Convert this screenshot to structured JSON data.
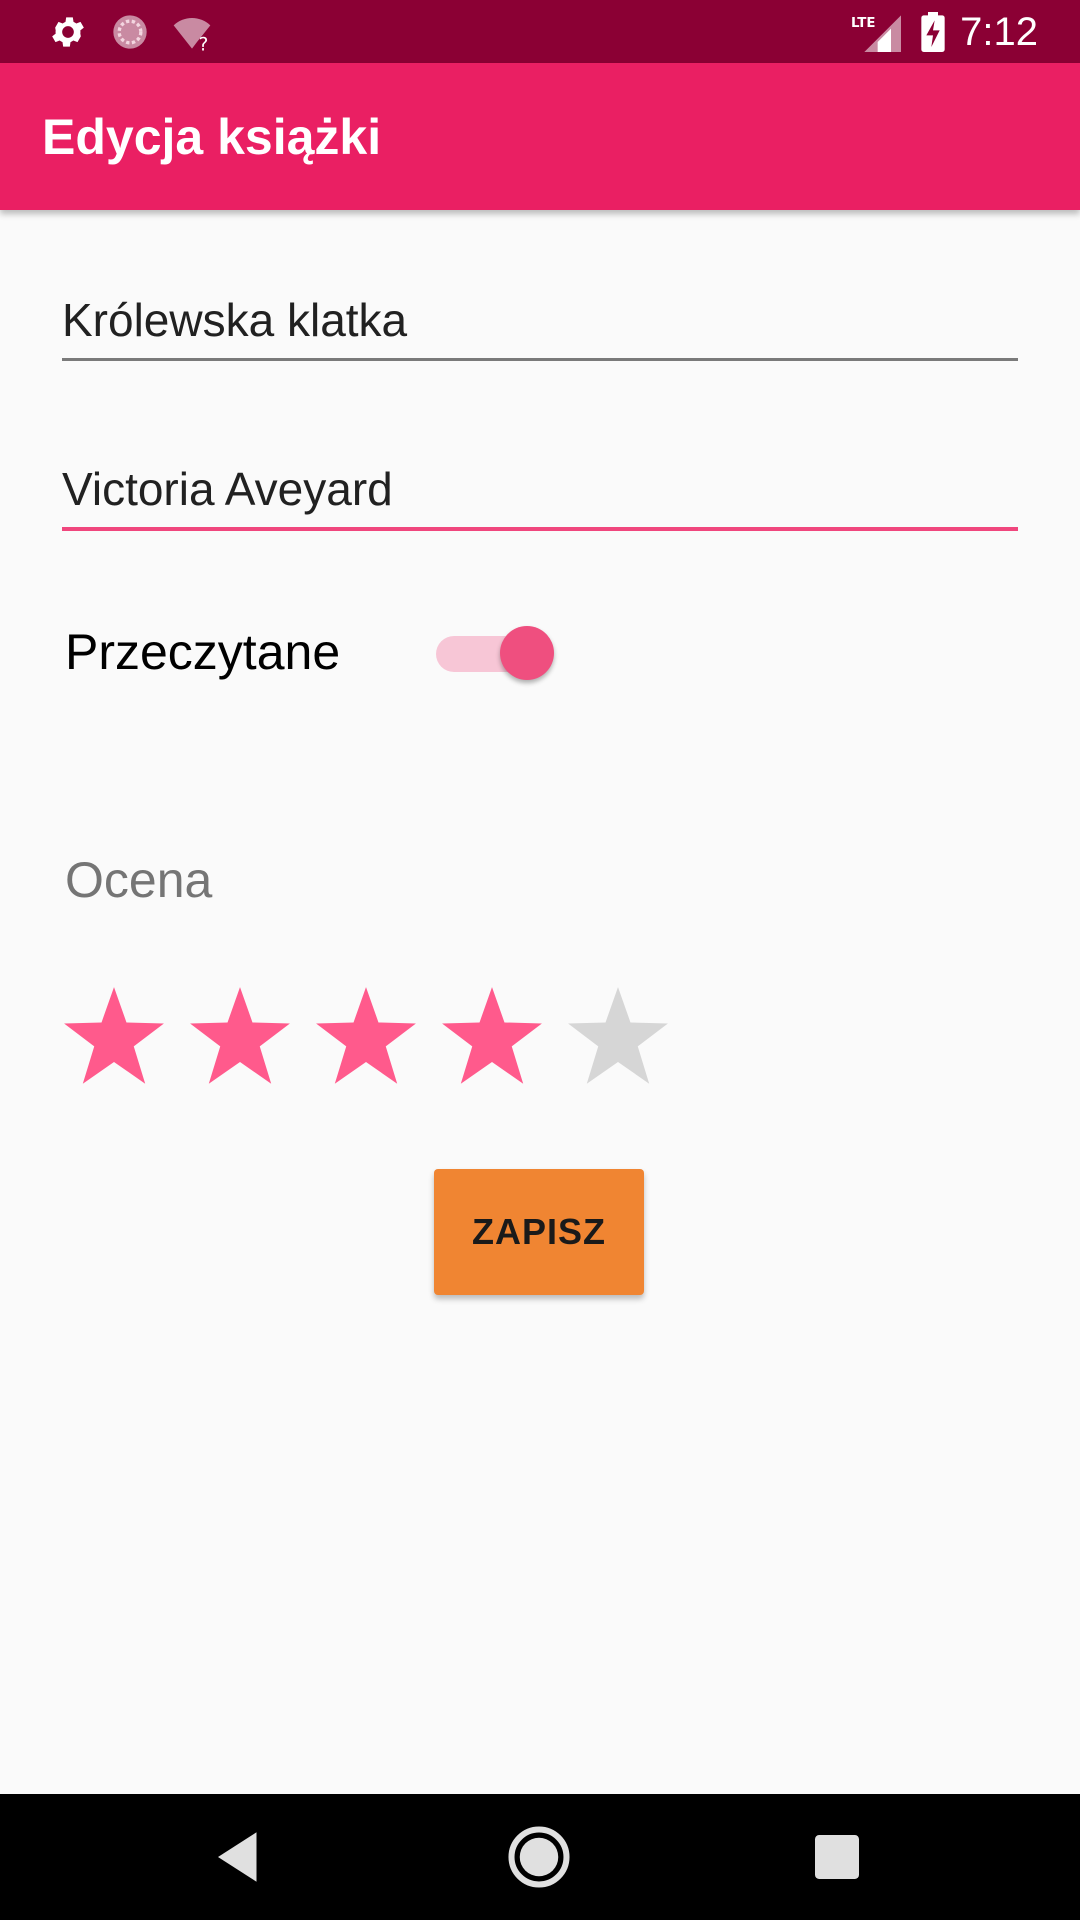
{
  "status_bar": {
    "time": "7:12",
    "network": "LTE",
    "icons": [
      "settings-icon",
      "sync-icon",
      "wifi-unknown-icon",
      "lte-signal-icon",
      "battery-charging-icon"
    ],
    "background_color": "#8b0034"
  },
  "app_bar": {
    "title": "Edycja książki",
    "background_color": "#ea1f63"
  },
  "form": {
    "title_value": "Królewska klatka",
    "author_value": "Victoria Aveyard",
    "read_label": "Przeczytane",
    "read_switch_on": true,
    "rating_label": "Ocena",
    "rating_value": 4,
    "rating_max": 5,
    "save_label": "ZAPISZ"
  },
  "colors": {
    "accent": "#f0467d",
    "star_filled": "#ff5a8c",
    "star_empty": "#d6d6d6",
    "button": "#f08532"
  },
  "nav_bar": {
    "buttons": [
      "back-icon",
      "home-icon",
      "recents-icon"
    ]
  }
}
